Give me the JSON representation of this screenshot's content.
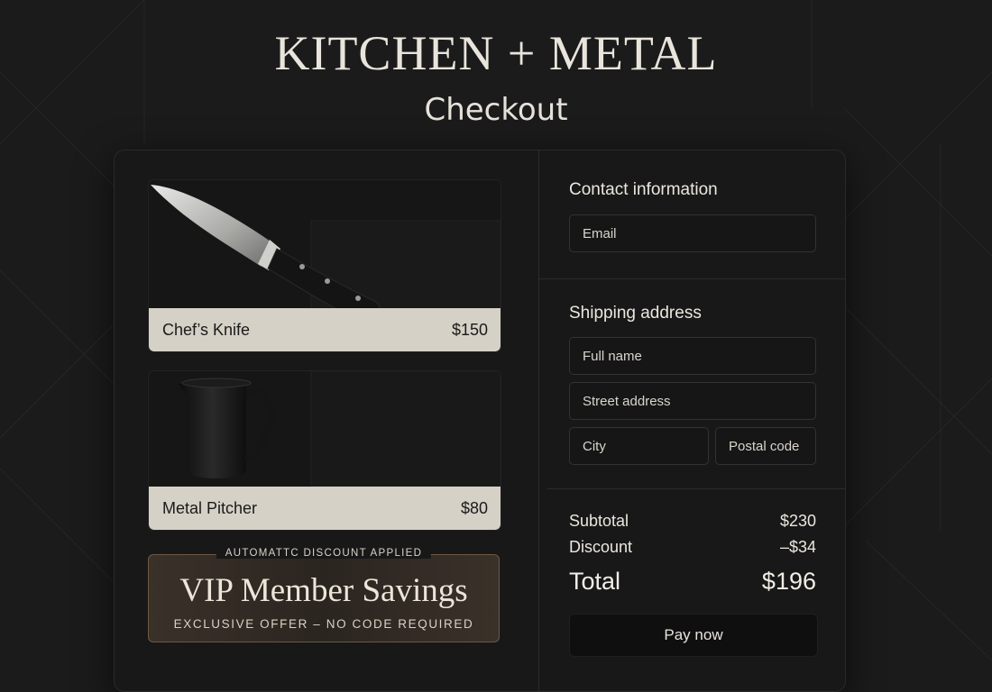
{
  "header": {
    "brand": "KITCHEN + METAL",
    "page_title": "Checkout"
  },
  "products": [
    {
      "name": "Chef’s Knife",
      "price": "$150",
      "icon": "chef-knife-image"
    },
    {
      "name": "Metal Pitcher",
      "price": "$80",
      "icon": "metal-pitcher-image"
    }
  ],
  "promo": {
    "tag": "AUTOMATTC DISCOUNT APPLIED",
    "title": "VIP Member Savings",
    "subtitle": "EXCLUSIVE OFFER – NO CODE REQUIRED"
  },
  "contact": {
    "title": "Contact information",
    "email_placeholder": "Email"
  },
  "shipping": {
    "title": "Shipping address",
    "full_name_placeholder": "Full name",
    "street_placeholder": "Street address",
    "city_placeholder": "City",
    "postal_placeholder": "Postal code"
  },
  "summary": {
    "subtotal_label": "Subtotal",
    "subtotal_value": "$230",
    "discount_label": "Discount",
    "discount_value": "–$34",
    "total_label": "Total",
    "total_value": "$196"
  },
  "actions": {
    "pay_label": "Pay now"
  },
  "colors": {
    "background": "#1b1b1b",
    "label_bar": "#d6d1c7",
    "promo_border": "#6b5843"
  }
}
